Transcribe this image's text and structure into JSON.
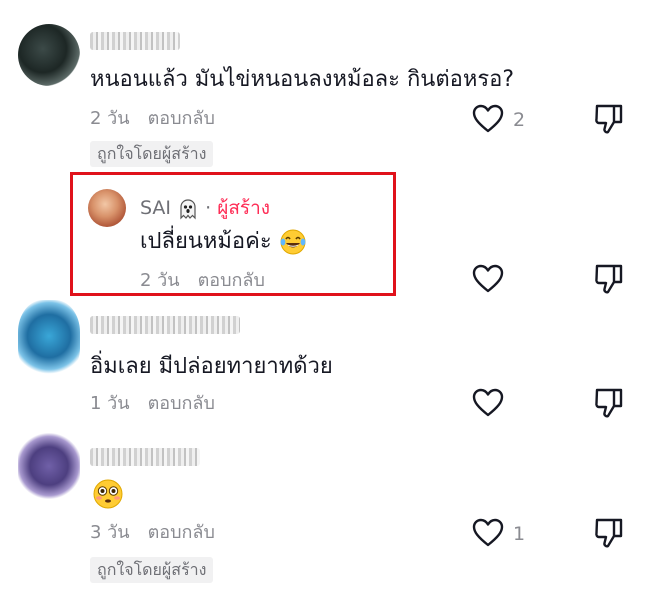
{
  "comments": [
    {
      "text": "หนอนแล้ว มันไข่หนอนลงหม้อละ กินต่อหรอ?",
      "time": "2 วัน",
      "reply_label": "ตอบกลับ",
      "like_count": "2",
      "creator_liked": "ถูกใจโดยผู้สร้าง"
    },
    {
      "username": "SAI",
      "dot": "·",
      "creator_label": "ผู้สร้าง",
      "text": "เปลี่ยนหม้อค่ะ",
      "time": "2 วัน",
      "reply_label": "ตอบกลับ"
    },
    {
      "text": "อิ่มเลย มีปล่อยทายาทด้วย",
      "time": "1 วัน",
      "reply_label": "ตอบกลับ"
    },
    {
      "time": "3 วัน",
      "reply_label": "ตอบกลับ",
      "like_count": "1",
      "creator_liked": "ถูกใจโดยผู้สร้าง"
    }
  ],
  "icons": {
    "like": "heart-outline-icon",
    "dislike": "thumbs-down-outline-icon",
    "ghost": "ghost-emoji-icon",
    "laugh": "tears-of-joy-emoji-icon",
    "flushed": "flushed-face-emoji-icon"
  },
  "colors": {
    "creator_accent": "#fe2c55",
    "highlight_border": "#e0121b",
    "meta_gray": "#8a8b91"
  }
}
